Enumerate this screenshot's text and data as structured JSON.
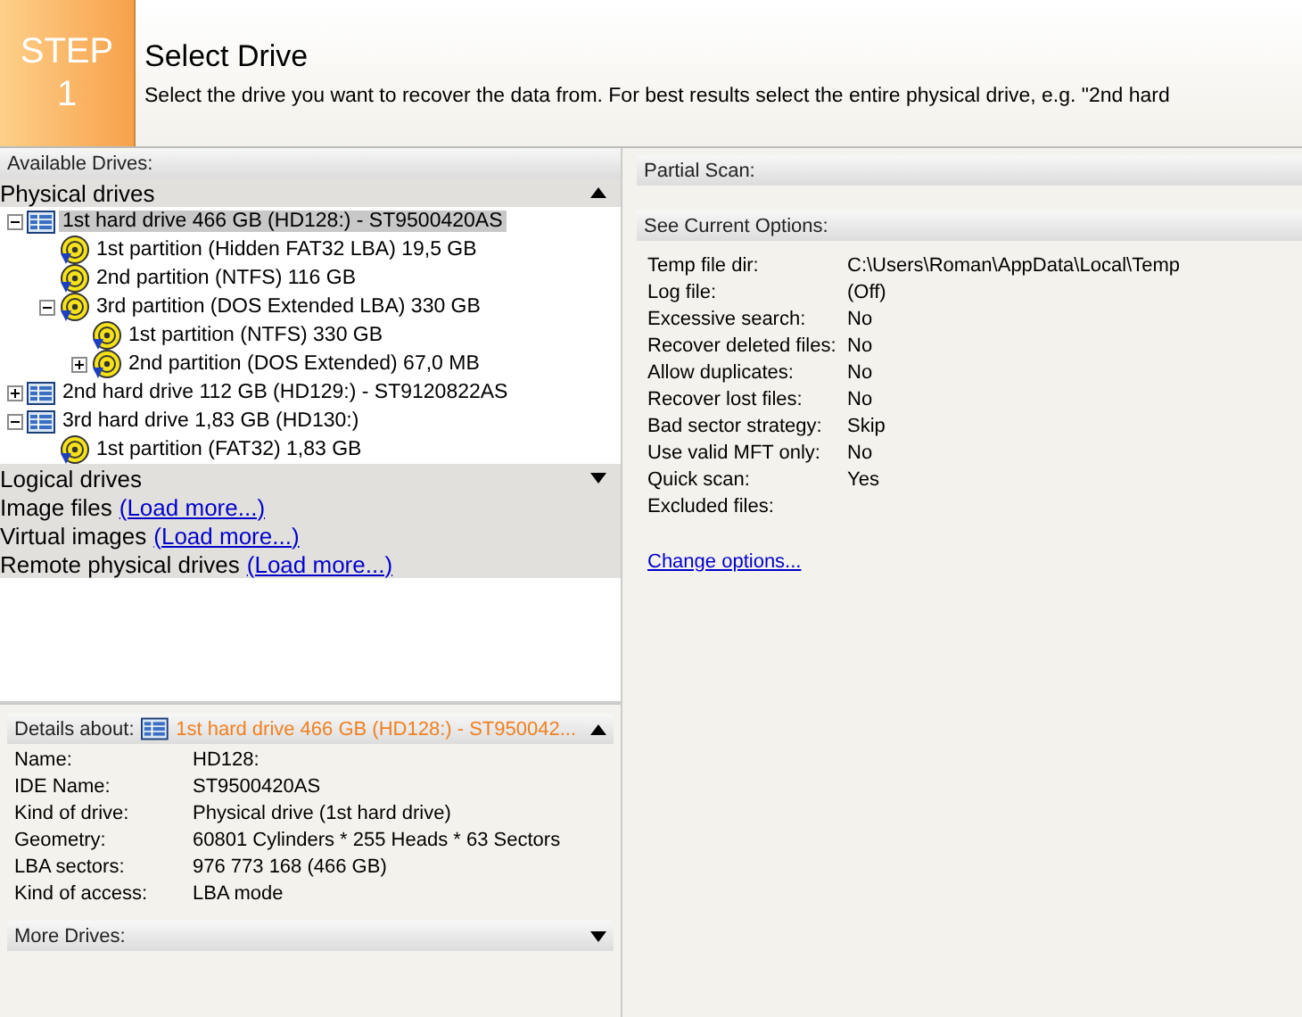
{
  "header": {
    "step_label": "STEP",
    "step_number": "1",
    "title": "Select Drive",
    "description": "Select the drive you want to recover the data from. For best results select the entire physical drive, e.g. \"2nd hard"
  },
  "drives_panel": {
    "title": "Available Drives:",
    "groups": [
      {
        "label": "Physical drives",
        "expanded": true,
        "tree": [
          {
            "kind": "drive",
            "label": "1st hard drive 466 GB (HD128:) - ST9500420AS",
            "selected": true,
            "expanded": true,
            "children": [
              {
                "kind": "partition",
                "label": "1st partition (Hidden FAT32 LBA) 19,5 GB",
                "selected": false
              },
              {
                "kind": "partition",
                "label": "2nd partition (NTFS) 116 GB",
                "selected": false
              },
              {
                "kind": "partition",
                "label": "3rd partition (DOS Extended LBA) 330 GB",
                "selected": false,
                "expanded": true,
                "children": [
                  {
                    "kind": "partition",
                    "label": "1st partition (NTFS) 330 GB",
                    "selected": false
                  },
                  {
                    "kind": "partition",
                    "label": "2nd partition (DOS Extended) 67,0 MB",
                    "selected": false,
                    "expanded": false
                  }
                ]
              }
            ]
          },
          {
            "kind": "drive",
            "label": "2nd hard drive 112 GB (HD129:) - ST9120822AS",
            "selected": false,
            "expanded": false
          },
          {
            "kind": "drive",
            "label": "3rd hard drive 1,83 GB (HD130:)",
            "selected": false,
            "expanded": true,
            "children": [
              {
                "kind": "partition",
                "label": "1st partition (FAT32) 1,83 GB",
                "selected": false
              }
            ]
          }
        ]
      },
      {
        "label": "Logical drives",
        "expanded": false
      }
    ],
    "sources": [
      {
        "label": "Image files",
        "link": "(Load more...)"
      },
      {
        "label": "Virtual images",
        "link": "(Load more...)"
      },
      {
        "label": "Remote physical drives",
        "link": "(Load more...)"
      }
    ]
  },
  "details": {
    "title": "Details about:",
    "drive": "1st hard drive 466 GB (HD128:) - ST950042...",
    "expanded": true,
    "rows": [
      {
        "label": "Name:",
        "value": "HD128:"
      },
      {
        "label": "IDE Name:",
        "value": "ST9500420AS"
      },
      {
        "label": "Kind of drive:",
        "value": "Physical drive (1st hard drive)"
      },
      {
        "label": "Geometry:",
        "value": "60801 Cylinders * 255 Heads * 63 Sectors"
      },
      {
        "label": "LBA sectors:",
        "value": "976 773 168 (466 GB)"
      },
      {
        "label": "Kind of access:",
        "value": "LBA mode"
      }
    ]
  },
  "more_drives": {
    "title": "More Drives:",
    "expanded": false
  },
  "partial_scan": {
    "title": "Partial Scan:"
  },
  "options": {
    "title": "See Current Options:",
    "rows": [
      {
        "label": "Temp file dir:",
        "value": "C:\\Users\\Roman\\AppData\\Local\\Temp"
      },
      {
        "label": "Log file:",
        "value": "(Off)"
      },
      {
        "label": "Excessive search:",
        "value": "No"
      },
      {
        "label": "Recover deleted files:",
        "value": "No"
      },
      {
        "label": "Allow duplicates:",
        "value": "No"
      },
      {
        "label": "Recover lost files:",
        "value": "No"
      },
      {
        "label": "Bad sector strategy:",
        "value": "Skip"
      },
      {
        "label": "Use valid MFT only:",
        "value": "No"
      },
      {
        "label": "Quick scan:",
        "value": "Yes"
      },
      {
        "label": "Excluded files:"
      }
    ],
    "link": "Change options..."
  }
}
